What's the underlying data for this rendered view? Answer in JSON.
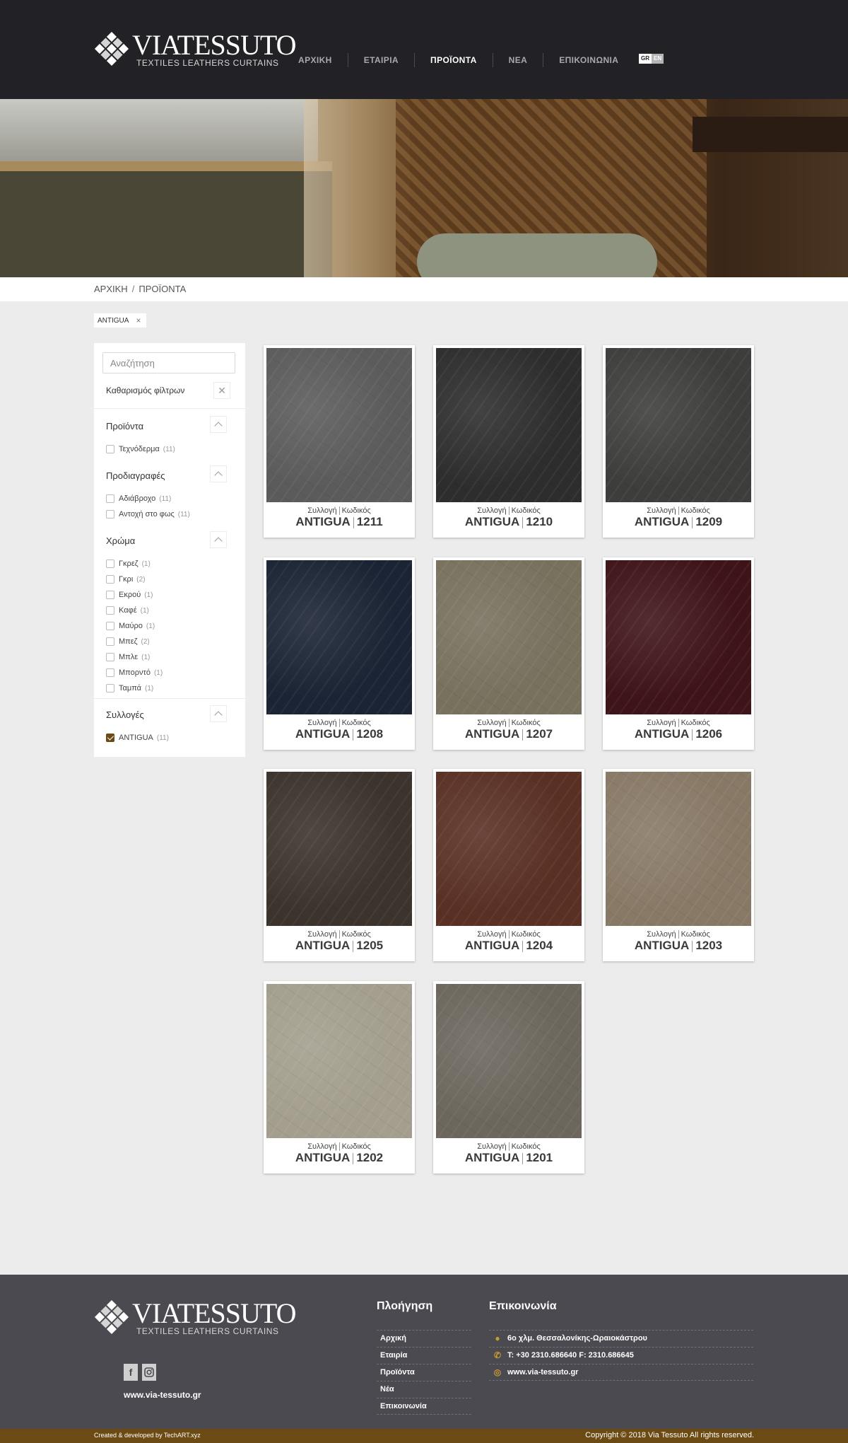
{
  "brand": {
    "name": "VIATESSUTO",
    "tagline": "TEXTILES LEATHERS CURTAINS"
  },
  "nav": {
    "items": [
      {
        "label": "ΑΡΧΙΚΗ"
      },
      {
        "label": "ΕΤΑΙΡΙΑ"
      },
      {
        "label": "ΠΡΟΪΟΝΤΑ"
      },
      {
        "label": "ΝΕΑ"
      },
      {
        "label": "ΕΠΙΚΟΙΝΩΝΙΑ"
      }
    ],
    "active": "ΠΡΟΪΟΝΤΑ",
    "lang": {
      "gr": "GR",
      "en": "EN"
    }
  },
  "breadcrumb": {
    "home": "ΑΡΧΙΚΗ",
    "sep": "/",
    "current": "ΠΡΟΪΟΝΤΑ"
  },
  "active_filter": {
    "label": "ANTIGUA",
    "remove": "×"
  },
  "sidebar": {
    "search_placeholder": "Αναζήτηση",
    "clear_label": "Καθαρισμός φίλτρων",
    "clear_icon": "close-icon",
    "sections": {
      "products": {
        "title": "Προϊόντα",
        "options": [
          {
            "label": "Τεχνόδερμα",
            "count": "(11)",
            "checked": false
          }
        ]
      },
      "specs": {
        "title": "Προδιαγραφές",
        "options": [
          {
            "label": "Αδιάβροχο",
            "count": "(11)",
            "checked": false
          },
          {
            "label": "Αντοχή στο φως",
            "count": "(11)",
            "checked": false
          }
        ]
      },
      "color": {
        "title": "Χρώμα",
        "options": [
          {
            "label": "Γκρεζ",
            "count": "(1)",
            "checked": false
          },
          {
            "label": "Γκρι",
            "count": "(2)",
            "checked": false
          },
          {
            "label": "Εκρού",
            "count": "(1)",
            "checked": false
          },
          {
            "label": "Καφέ",
            "count": "(1)",
            "checked": false
          },
          {
            "label": "Μαύρο",
            "count": "(1)",
            "checked": false
          },
          {
            "label": "Μπεζ",
            "count": "(2)",
            "checked": false
          },
          {
            "label": "Μπλε",
            "count": "(1)",
            "checked": false
          },
          {
            "label": "Μπορντό",
            "count": "(1)",
            "checked": false
          },
          {
            "label": "Ταμπά",
            "count": "(1)",
            "checked": false
          }
        ]
      },
      "collections": {
        "title": "Συλλογές",
        "options": [
          {
            "label": "ANTIGUA",
            "count": "(11)",
            "checked": true
          }
        ]
      }
    }
  },
  "product_labels": {
    "collection": "Συλλογή",
    "code": "Κωδικός"
  },
  "products": [
    {
      "collection": "ANTIGUA",
      "code": "1211",
      "color": "#5b5b5b"
    },
    {
      "collection": "ANTIGUA",
      "code": "1210",
      "color": "#2d2d2d"
    },
    {
      "collection": "ANTIGUA",
      "code": "1209",
      "color": "#3d3e3b"
    },
    {
      "collection": "ANTIGUA",
      "code": "1208",
      "color": "#1b2434"
    },
    {
      "collection": "ANTIGUA",
      "code": "1207",
      "color": "#77715e"
    },
    {
      "collection": "ANTIGUA",
      "code": "1206",
      "color": "#3f1419"
    },
    {
      "collection": "ANTIGUA",
      "code": "1205",
      "color": "#3b332c"
    },
    {
      "collection": "ANTIGUA",
      "code": "1204",
      "color": "#5a3024"
    },
    {
      "collection": "ANTIGUA",
      "code": "1203",
      "color": "#887966"
    },
    {
      "collection": "ANTIGUA",
      "code": "1202",
      "color": "#a39e8d"
    },
    {
      "collection": "ANTIGUA",
      "code": "1201",
      "color": "#6c665d"
    }
  ],
  "footer": {
    "website": "www.via-tessuto.gr",
    "social": [
      "facebook-icon",
      "instagram-icon"
    ],
    "nav_title": "Πλοήγηση",
    "nav_links": [
      "Αρχική",
      "Εταιρία",
      "Προϊόντα",
      "Νέα",
      "Επικοινωνία"
    ],
    "contact_title": "Επικοινωνία",
    "contact": [
      {
        "icon": "map-pin-icon",
        "text": "6ο χλμ. Θεσσαλονίκης-Ωραιοκάστρου"
      },
      {
        "icon": "phone-icon",
        "text": "T: +30 2310.686640 F: 2310.686645"
      },
      {
        "icon": "globe-icon",
        "text": "www.via-tessuto.gr"
      }
    ],
    "credit": "Created & developed by TechART.xyz",
    "copyright": "Copyright © 2018 Via Tessuto All rights reserved."
  },
  "colors": {
    "accent": "#c99a30",
    "bar": "#6b4a13",
    "header": "#222126",
    "footer": "#4a4a50"
  }
}
